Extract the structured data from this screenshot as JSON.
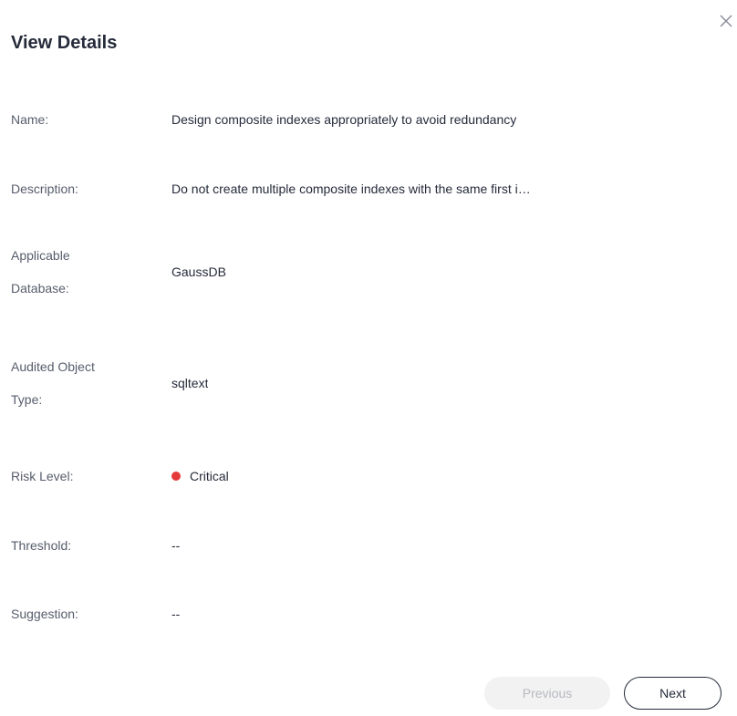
{
  "dialog": {
    "title": "View Details",
    "close_icon": "close-icon"
  },
  "details": {
    "name": {
      "label": "Name:",
      "value": "Design composite indexes appropriately to avoid redundancy"
    },
    "description": {
      "label": "Description:",
      "value": "Do not create multiple composite indexes with the same first i…"
    },
    "applicable_database": {
      "label_line1": "Applicable",
      "label_line2": "Database:",
      "value": "GaussDB"
    },
    "audited_object_type": {
      "label_line1": "Audited Object",
      "label_line2": "Type:",
      "value": "sqltext"
    },
    "risk_level": {
      "label": "Risk Level:",
      "value": "Critical",
      "color": "#e5383b"
    },
    "threshold": {
      "label": "Threshold:",
      "value": "--"
    },
    "suggestion": {
      "label": "Suggestion:",
      "value": "--"
    }
  },
  "footer": {
    "previous_label": "Previous",
    "next_label": "Next"
  }
}
